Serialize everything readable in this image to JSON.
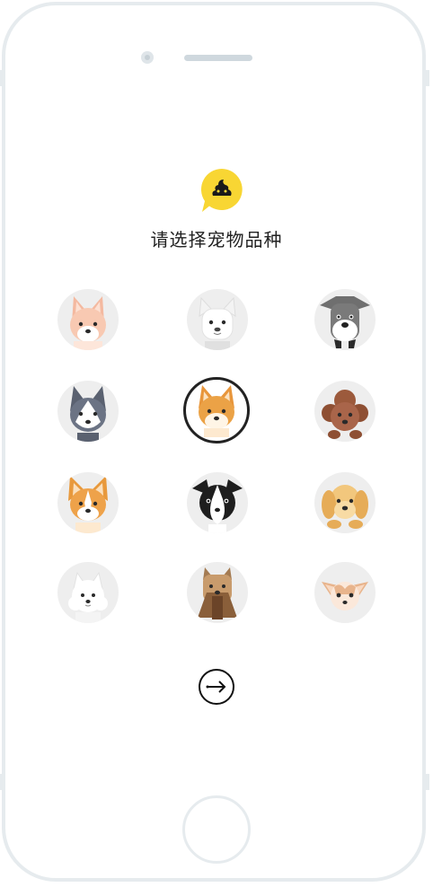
{
  "colors": {
    "accent": "#f8d633",
    "frame": "#e6ebee",
    "avatar_bg": "#eeeeee",
    "selected_border": "#222222"
  },
  "header": {
    "logo_icon": "poop-chat-bubble-icon",
    "title": "请选择宠物品种"
  },
  "breeds": [
    {
      "icon": "shiba-cream-icon",
      "selected": false
    },
    {
      "icon": "french-bulldog-icon",
      "selected": false
    },
    {
      "icon": "schnauzer-icon",
      "selected": false
    },
    {
      "icon": "husky-icon",
      "selected": false
    },
    {
      "icon": "shiba-inu-icon",
      "selected": true
    },
    {
      "icon": "poodle-icon",
      "selected": false
    },
    {
      "icon": "corgi-icon",
      "selected": false
    },
    {
      "icon": "border-collie-icon",
      "selected": false
    },
    {
      "icon": "golden-retriever-icon",
      "selected": false
    },
    {
      "icon": "samoyed-icon",
      "selected": false
    },
    {
      "icon": "yorkshire-terrier-icon",
      "selected": false
    },
    {
      "icon": "chihuahua-icon",
      "selected": false
    }
  ],
  "footer": {
    "next_icon": "arrow-right-icon"
  }
}
